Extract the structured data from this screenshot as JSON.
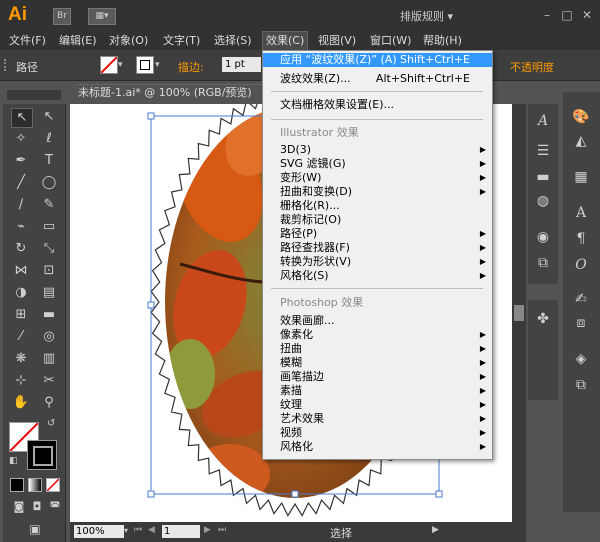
{
  "app": {
    "logo": "Ai",
    "bridge_label": "Br",
    "workspace": "排版规则",
    "win_minimize": "–",
    "win_maximize": "□",
    "win_close": "✕"
  },
  "menubar": [
    {
      "label": "文件(F)"
    },
    {
      "label": "编辑(E)"
    },
    {
      "label": "对象(O)"
    },
    {
      "label": "文字(T)"
    },
    {
      "label": "选择(S)"
    },
    {
      "label": "效果(C)"
    },
    {
      "label": "视图(V)"
    },
    {
      "label": "窗口(W)"
    },
    {
      "label": "帮助(H)"
    }
  ],
  "controlbar": {
    "path_label": "路径",
    "stroke_label": "描边:",
    "stroke_value": "1 pt",
    "opacity_label": "不透明度"
  },
  "document": {
    "tab_title": "未标题-1.ai* @ 100% (RGB/预览)",
    "tab_close": "✕"
  },
  "statusbar": {
    "zoom": "100%",
    "page": "1",
    "status": "选择"
  },
  "dropdown": {
    "items": [
      {
        "label": "应用 “波纹效果(Z)” (A)",
        "shortcut": "Shift+Ctrl+E",
        "highlight": true
      },
      {
        "label": "波纹效果(Z)...",
        "shortcut": "Alt+Shift+Ctrl+E"
      },
      {
        "label": "文档栅格效果设置(E)..."
      }
    ],
    "illustrator_header": "Illustrator 效果",
    "illustrator_items": [
      {
        "label": "3D(3)",
        "submenu": true
      },
      {
        "label": "SVG 滤镜(G)",
        "submenu": true
      },
      {
        "label": "变形(W)",
        "submenu": true
      },
      {
        "label": "扭曲和变换(D)",
        "submenu": true
      },
      {
        "label": "栅格化(R)..."
      },
      {
        "label": "裁剪标记(O)"
      },
      {
        "label": "路径(P)",
        "submenu": true
      },
      {
        "label": "路径查找器(F)",
        "submenu": true
      },
      {
        "label": "转换为形状(V)",
        "submenu": true
      },
      {
        "label": "风格化(S)",
        "submenu": true
      }
    ],
    "photoshop_header": "Photoshop 效果",
    "photoshop_items": [
      {
        "label": "效果画廊..."
      },
      {
        "label": "像素化",
        "submenu": true
      },
      {
        "label": "扭曲",
        "submenu": true
      },
      {
        "label": "模糊",
        "submenu": true
      },
      {
        "label": "画笔描边",
        "submenu": true
      },
      {
        "label": "素描",
        "submenu": true
      },
      {
        "label": "纹理",
        "submenu": true
      },
      {
        "label": "艺术效果",
        "submenu": true
      },
      {
        "label": "视频",
        "submenu": true
      },
      {
        "label": "风格化",
        "submenu": true
      }
    ],
    "submenu_arrow": "▶"
  }
}
